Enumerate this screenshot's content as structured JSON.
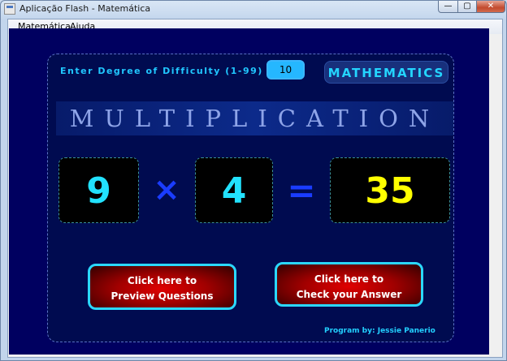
{
  "window": {
    "title": "Aplicação Flash - Matemática",
    "controls": {
      "minimize": "—",
      "maximize": "▢",
      "close": "✕"
    }
  },
  "menu": {
    "items": [
      "Matemática",
      "Ajuda"
    ]
  },
  "game": {
    "difficulty_label": "Enter Degree of Difficulty (1-99)",
    "difficulty_value": "10",
    "badge": "MATHEMATICS",
    "mode_title": "MULTIPLICATION",
    "operand_a": "9",
    "operator": "×",
    "operand_b": "4",
    "equals": "=",
    "answer": "35",
    "preview_button": {
      "line1": "Click here to",
      "line2": "Preview Questions"
    },
    "check_button": {
      "line1": "Click here to",
      "line2": "Check your Answer"
    },
    "credit": "Program by: Jessie Panerio"
  },
  "colors": {
    "stage_bg": "#000060",
    "number_color": "#22e2ff",
    "answer_color": "#ffff00",
    "operator_color": "#1a3cff",
    "button_border": "#2bd8ff",
    "button_fill": "#c00000"
  }
}
